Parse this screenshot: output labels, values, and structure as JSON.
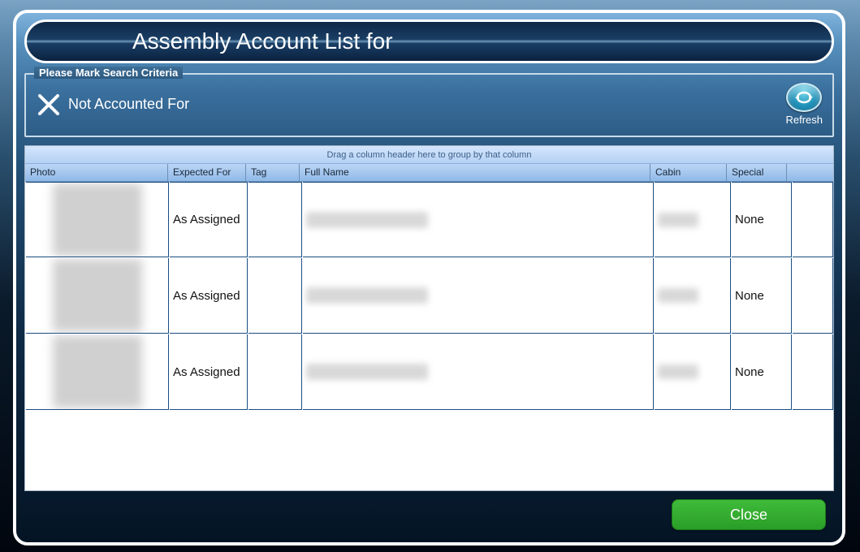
{
  "title": "Assembly Account List for",
  "search_criteria": {
    "legend": "Please Mark Search Criteria",
    "selected_label": "Not Accounted For",
    "refresh_label": "Refresh"
  },
  "grid": {
    "group_hint": "Drag a column header here to group by that column",
    "columns": {
      "photo": "Photo",
      "expected": "Expected For",
      "tag": "Tag",
      "full_name": "Full Name",
      "cabin": "Cabin",
      "special": "Special"
    },
    "rows": [
      {
        "expected": "As Assigned",
        "tag": "",
        "full_name": "",
        "cabin": "",
        "special": "None"
      },
      {
        "expected": "As Assigned",
        "tag": "",
        "full_name": "",
        "cabin": "",
        "special": "None"
      },
      {
        "expected": "As Assigned",
        "tag": "",
        "full_name": "",
        "cabin": "",
        "special": "None"
      }
    ]
  },
  "buttons": {
    "close": "Close"
  },
  "colors": {
    "accent_green": "#2fa82d",
    "header_blue": "#9cc2ef"
  }
}
